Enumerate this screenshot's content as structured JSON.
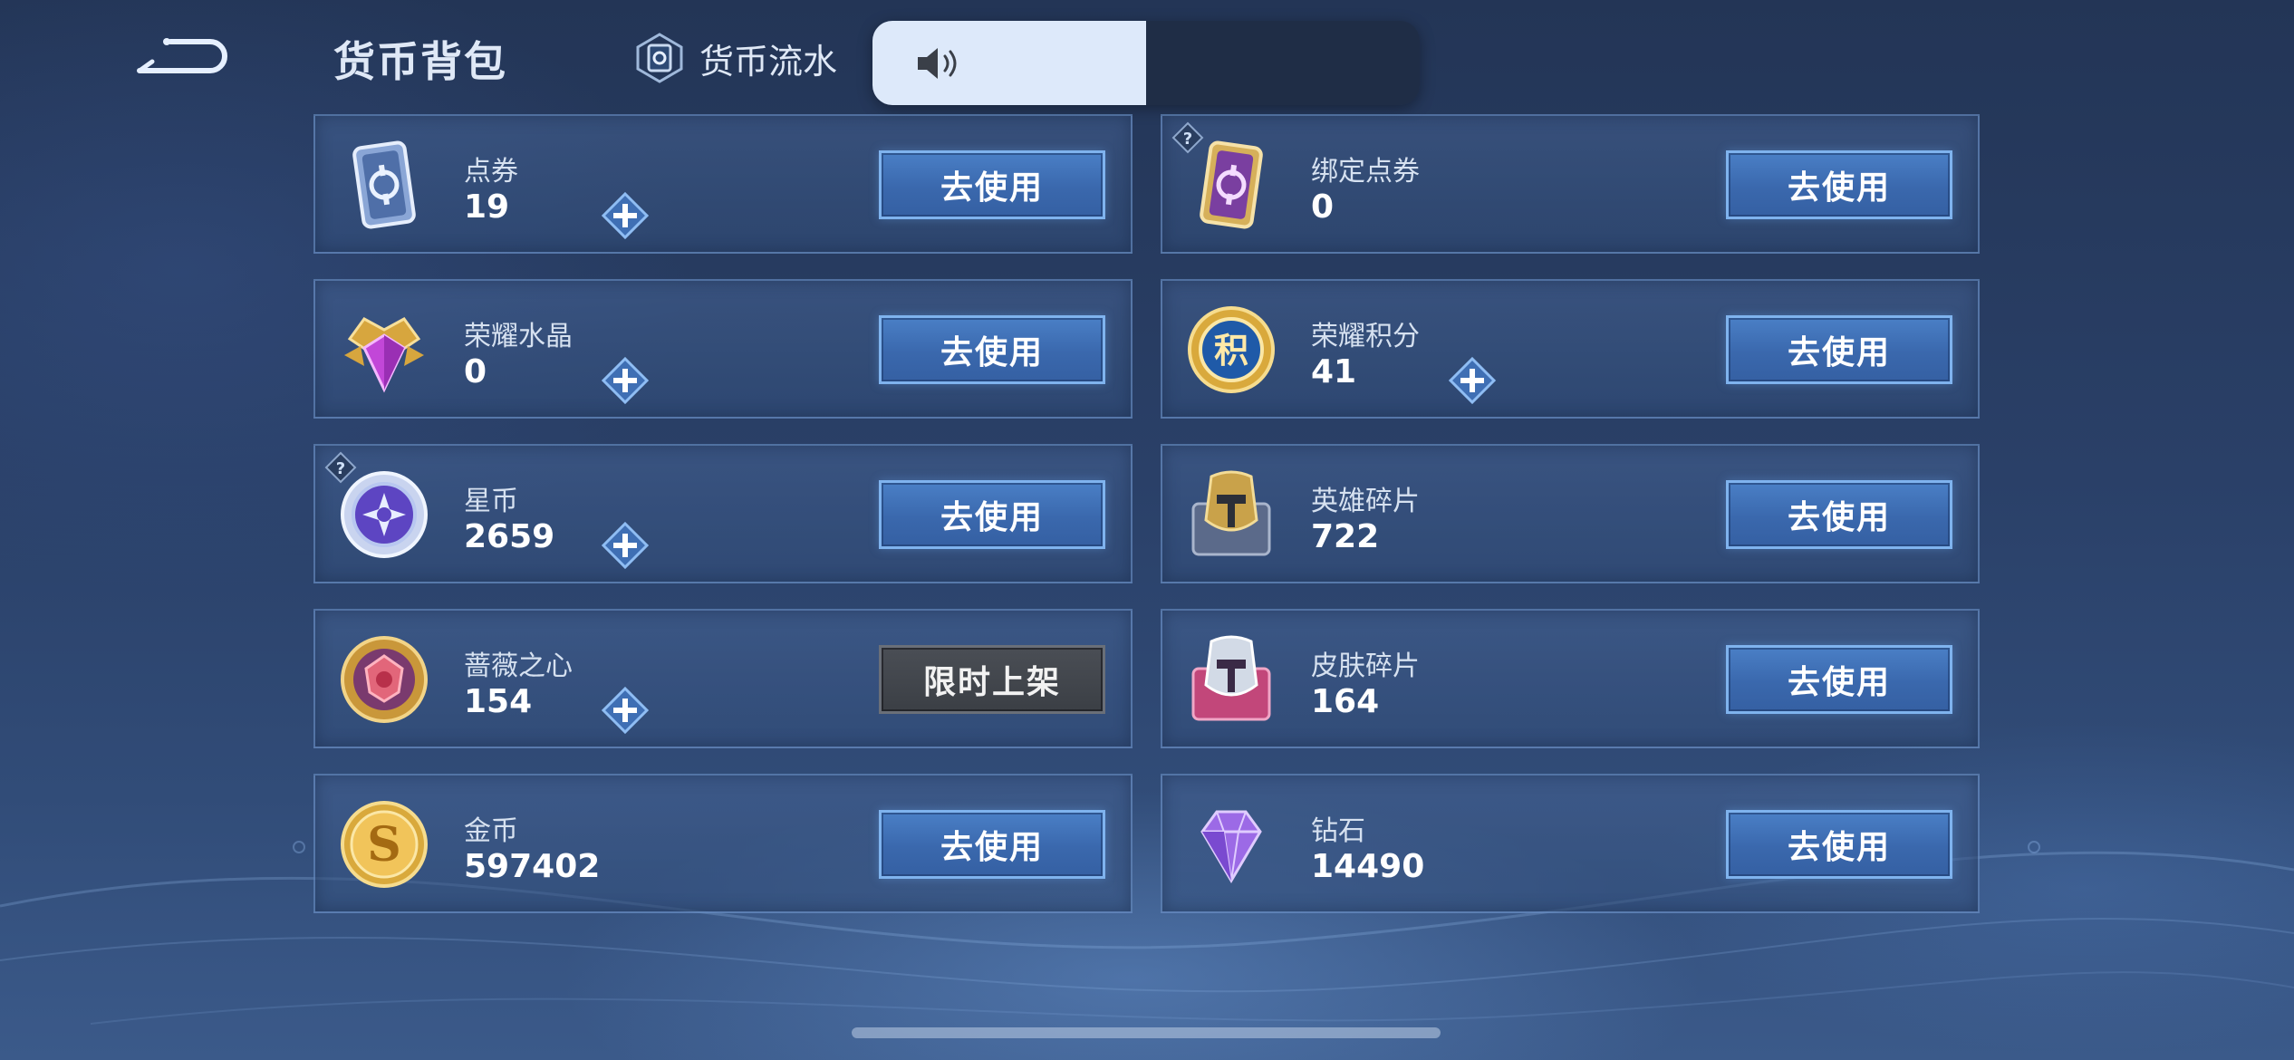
{
  "header": {
    "title": "货币背包",
    "flow_label": "货币流水"
  },
  "colors": {
    "use_button": "#3a68ad",
    "use_button_border": "#7fb3ee",
    "limited_button": "#3b3f45",
    "volume_fill": "#dde9fa"
  },
  "volume": {
    "level_fraction": 0.5,
    "icon": "speaker-icon"
  },
  "currencies": [
    {
      "id": "dianquan",
      "name": "点券",
      "amount": "19",
      "has_plus": true,
      "has_help": false,
      "button": "去使用",
      "icon": "ticket-blue-icon"
    },
    {
      "id": "bound-dianquan",
      "name": "绑定点券",
      "amount": "0",
      "has_plus": false,
      "has_help": true,
      "button": "去使用",
      "icon": "ticket-purple-icon"
    },
    {
      "id": "glory-crystal",
      "name": "荣耀水晶",
      "amount": "0",
      "has_plus": true,
      "has_help": false,
      "button": "去使用",
      "icon": "crystal-icon"
    },
    {
      "id": "glory-points",
      "name": "荣耀积分",
      "amount": "41",
      "has_plus": true,
      "has_help": false,
      "button": "去使用",
      "icon": "points-coin-icon"
    },
    {
      "id": "star-coin",
      "name": "星币",
      "amount": "2659",
      "has_plus": true,
      "has_help": true,
      "button": "去使用",
      "icon": "star-coin-icon"
    },
    {
      "id": "hero-shards",
      "name": "英雄碎片",
      "amount": "722",
      "has_plus": false,
      "has_help": false,
      "button": "去使用",
      "icon": "hero-shard-icon"
    },
    {
      "id": "rose-heart",
      "name": "蔷薇之心",
      "amount": "154",
      "has_plus": true,
      "has_help": false,
      "button": "限时上架",
      "icon": "rose-icon"
    },
    {
      "id": "skin-shards",
      "name": "皮肤碎片",
      "amount": "164",
      "has_plus": false,
      "has_help": false,
      "button": "去使用",
      "icon": "skin-shard-icon"
    },
    {
      "id": "gold",
      "name": "金币",
      "amount": "597402",
      "has_plus": false,
      "has_help": false,
      "button": "去使用",
      "icon": "gold-coin-icon"
    },
    {
      "id": "diamond",
      "name": "钻石",
      "amount": "14490",
      "has_plus": false,
      "has_help": false,
      "button": "去使用",
      "icon": "diamond-icon"
    }
  ]
}
